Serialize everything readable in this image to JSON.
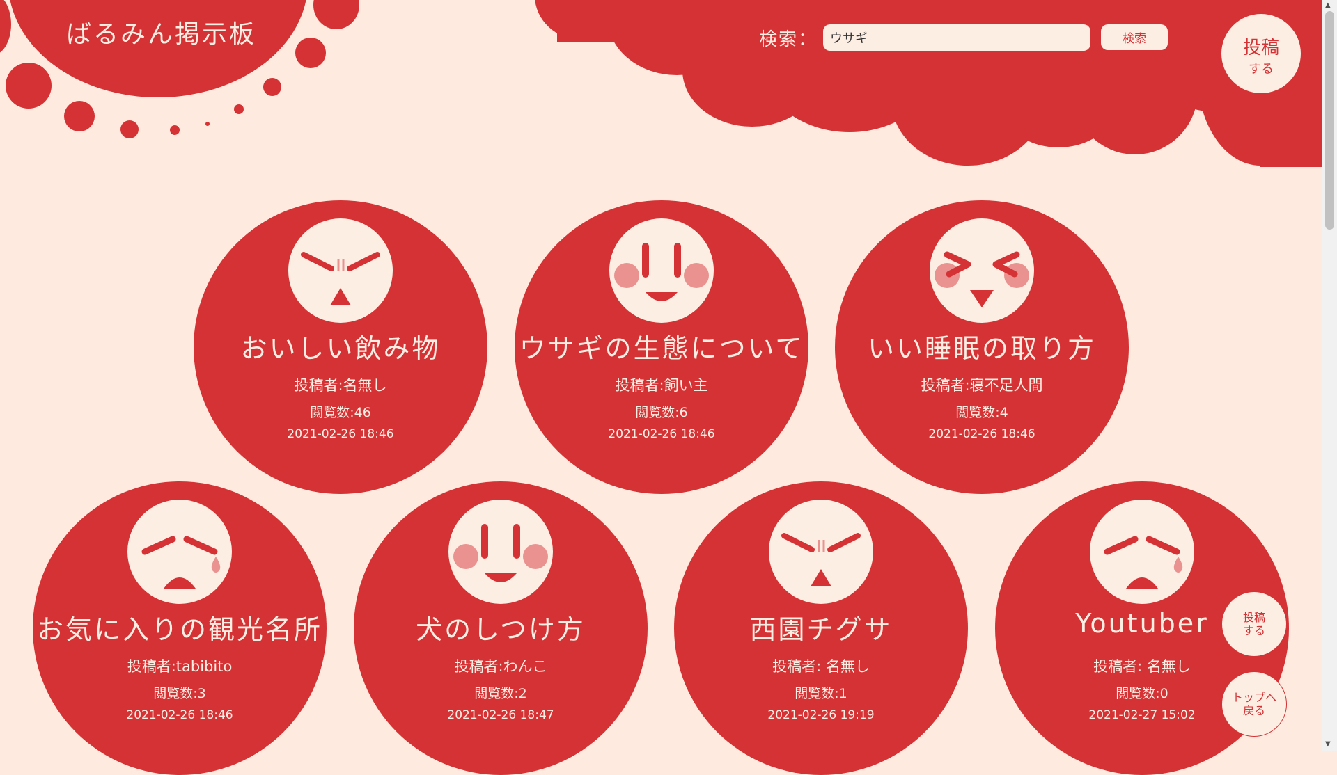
{
  "header": {
    "site_title": "ばるみん掲示板",
    "search_label": "検索：",
    "search_value": "ウサギ",
    "search_button": "検索",
    "post_button_line1": "投稿",
    "post_button_line2": "する"
  },
  "posts": [
    {
      "title": "おいしい飲み物",
      "author": "投稿者:名無し",
      "views": "閲覧数:46",
      "date": "2021-02-26 18:46",
      "face": "squint-face-icon"
    },
    {
      "title": "ウサギの生態について",
      "author": "投稿者:飼い主",
      "views": "閲覧数:6",
      "date": "2021-02-26 18:46",
      "face": "smile-face-icon"
    },
    {
      "title": "いい睡眠の取り方",
      "author": "投稿者:寝不足人間",
      "views": "閲覧数:4",
      "date": "2021-02-26 18:46",
      "face": "excited-face-icon"
    },
    {
      "title": "お気に入りの観光名所",
      "author": "投稿者:tabibito",
      "views": "閲覧数:3",
      "date": "2021-02-26 18:46",
      "face": "sad-face-icon"
    },
    {
      "title": "犬のしつけ方",
      "author": "投稿者:わんこ",
      "views": "閲覧数:2",
      "date": "2021-02-26 18:47",
      "face": "smile-face-icon"
    },
    {
      "title": "西園チグサ",
      "author": "投稿者: 名無し",
      "views": "閲覧数:1",
      "date": "2021-02-26 19:19",
      "face": "squint-face-icon"
    },
    {
      "title": "Youtuber",
      "author": "投稿者: 名無し",
      "views": "閲覧数:0",
      "date": "2021-02-27 15:02",
      "face": "sad-face-icon"
    }
  ],
  "floating": {
    "post_line1": "投稿",
    "post_line2": "する",
    "top_line1": "トップへ",
    "top_line2": "戻る"
  },
  "colors": {
    "primary": "#d43234",
    "background": "#feeade",
    "cream": "#fdeee4",
    "blush": "#e99290"
  }
}
